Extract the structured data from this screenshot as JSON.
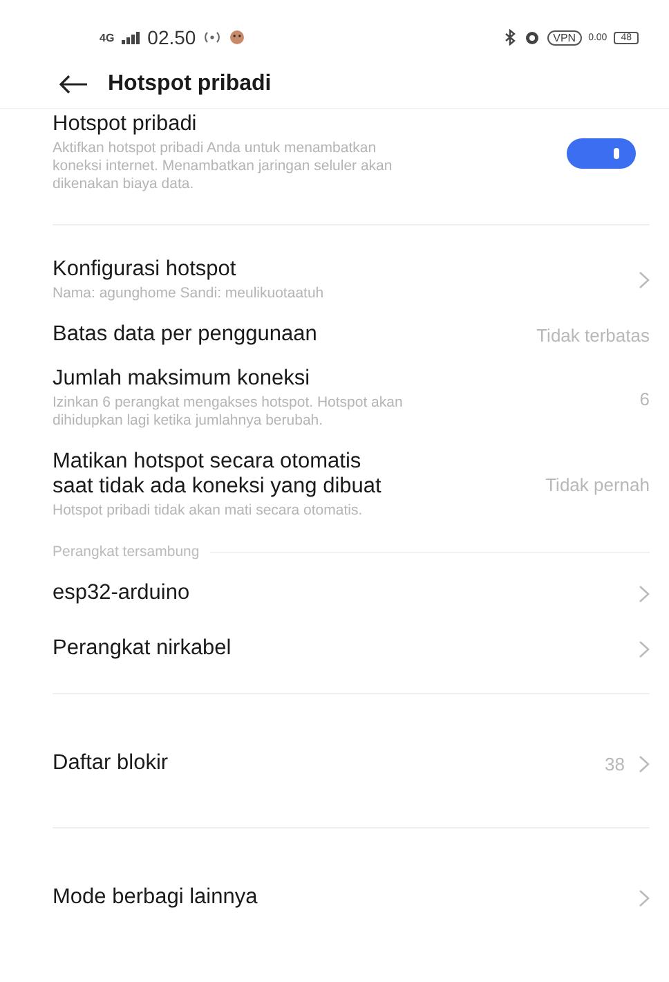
{
  "status_bar": {
    "network": "4G",
    "time": "02.50",
    "vpn": "VPN",
    "speed": "0.00",
    "battery": "48"
  },
  "header": {
    "title": "Hotspot pribadi"
  },
  "sections": [
    {
      "items": [
        {
          "kind": "toggle",
          "title": "Hotspot pribadi",
          "subtitle": "Aktifkan hotspot pribadi Anda untuk menambatkan koneksi internet. Menambatkan jaringan seluler akan dikenakan biaya data.",
          "on": true
        }
      ]
    },
    {
      "items": [
        {
          "kind": "row",
          "title": "Konfigurasi hotspot",
          "subtitle": "Nama: agunghome  Sandi: meulikuotaatuh",
          "chevron": true
        },
        {
          "kind": "row",
          "title": "Batas data per penggunaan",
          "value": "Tidak terbatas",
          "chevron": false
        },
        {
          "kind": "row",
          "title": "Jumlah maksimum koneksi",
          "subtitle": "Izinkan 6 perangkat mengakses hotspot. Hotspot akan dihidupkan lagi ketika jumlahnya berubah.",
          "value": "6",
          "chevron": false
        },
        {
          "kind": "row",
          "title": "Matikan hotspot secara otomatis saat tidak ada koneksi yang dibuat",
          "subtitle": "Hotspot pribadi tidak akan mati secara otomatis.",
          "value": "Tidak pernah",
          "chevron": false
        }
      ]
    },
    {
      "header": "Perangkat tersambung",
      "items": [
        {
          "kind": "row",
          "title": "esp32-arduino",
          "chevron": true
        },
        {
          "kind": "row",
          "title": "Perangkat nirkabel",
          "chevron": true
        }
      ]
    },
    {
      "items": [
        {
          "kind": "row",
          "title": "Daftar blokir",
          "value": "38",
          "chevron": true
        }
      ]
    },
    {
      "items": [
        {
          "kind": "row",
          "title": "Mode berbagi lainnya",
          "chevron": true
        }
      ]
    }
  ]
}
